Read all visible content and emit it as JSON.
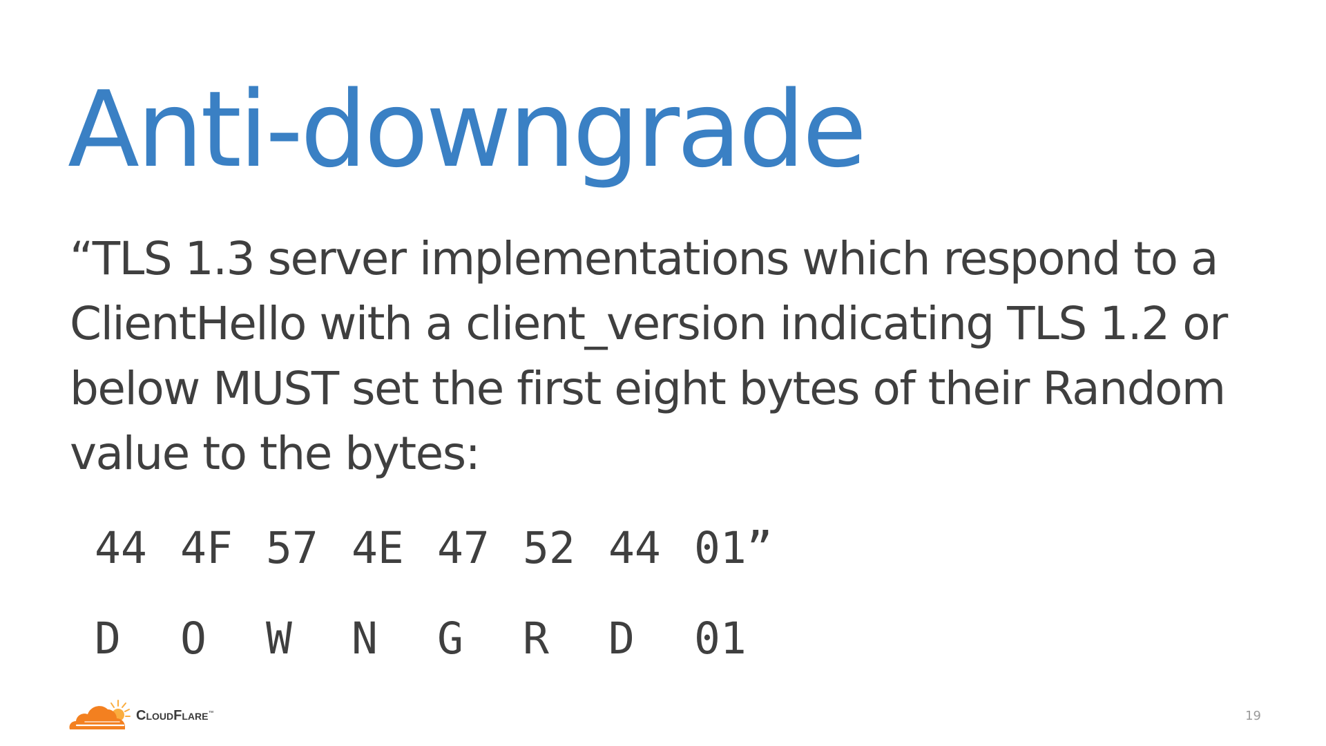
{
  "slide": {
    "title": "Anti-downgrade",
    "quote_lines": [
      "“TLS 1.3 server implementations which respond to a",
      "ClientHello with a client_version indicating TLS 1.2 or",
      "below MUST set the first eight bytes of their Random",
      "value to the bytes:"
    ],
    "hex_bytes": [
      "44",
      "4F",
      "57",
      "4E",
      "47",
      "52",
      "44",
      "01”"
    ],
    "ascii_chars": [
      "D",
      "O",
      "W",
      "N",
      "G",
      "R",
      "D",
      "01"
    ],
    "page_number": "19"
  },
  "logo": {
    "text": "CloudFlare",
    "trademark": "™",
    "icon": "cloudflare-cloud-icon",
    "colors": {
      "cloud": "#f38020",
      "sun": "#faad3f"
    }
  },
  "colors": {
    "title": "#3a80c4",
    "body_text": "#3f3f3f",
    "page_number": "#9a9a9a"
  }
}
